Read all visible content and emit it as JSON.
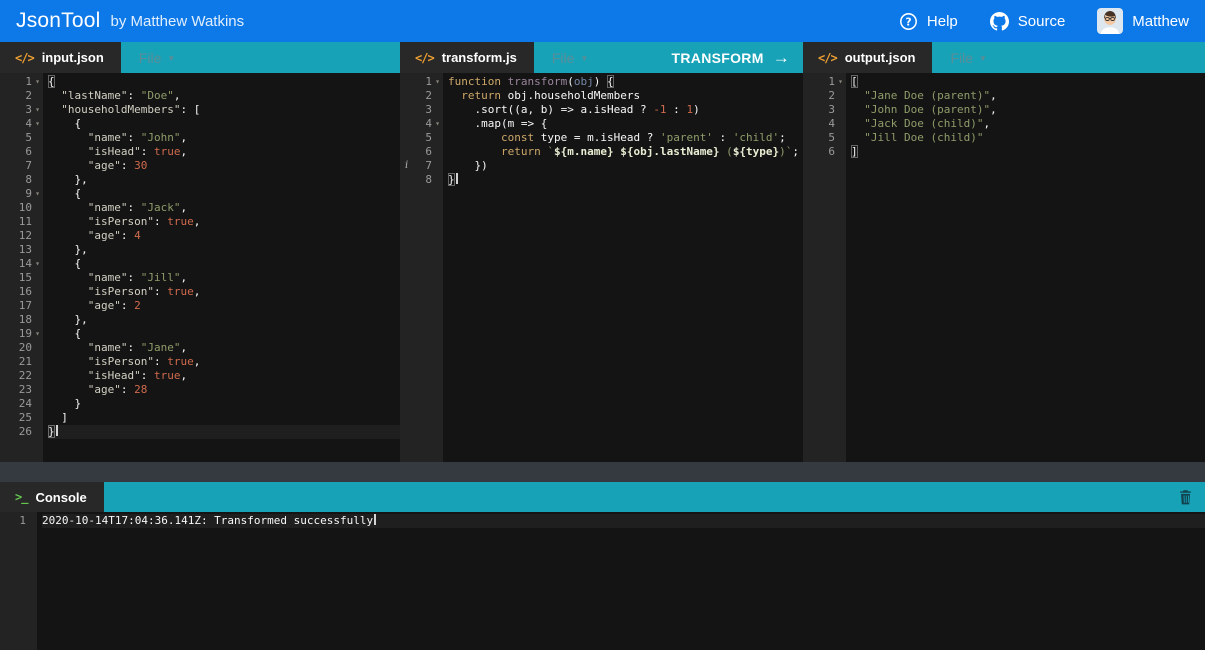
{
  "navbar": {
    "brand": "JsonTool",
    "byline": "by Matthew Watkins",
    "links": [
      {
        "icon": "help-circle-icon",
        "label": "Help"
      },
      {
        "icon": "github-icon",
        "label": "Source"
      },
      {
        "icon": "user-avatar",
        "label": "Matthew"
      }
    ]
  },
  "colors": {
    "navbar_blue": "#0d78e8",
    "panel_teal": "#17a2b8",
    "tab_dark": "#282828",
    "editor_background": "#141414",
    "gutter_background": "#232323",
    "string_green": "#8f9d6a",
    "number_red": "#cf6a4c",
    "keyword_tan": "#cda869"
  },
  "panels": {
    "input": {
      "tab_label": "input.json",
      "tab_icon": "code-icon",
      "menu_label": "File"
    },
    "transform": {
      "tab_label": "transform.js",
      "tab_icon": "code-icon",
      "menu_label": "File",
      "action_label": "TRANSFORM",
      "action_icon": "arrow-right-icon"
    },
    "output": {
      "tab_label": "output.json",
      "tab_icon": "code-icon",
      "menu_label": "File"
    },
    "console": {
      "tab_label": "Console",
      "tab_icon": "terminal-icon",
      "clear_icon": "trash-icon"
    }
  },
  "editors": {
    "input": {
      "lines": [
        {
          "tokens": [
            [
              "p",
              "{",
              "box"
            ]
          ],
          "fold": true
        },
        {
          "tokens": [
            [
              "k",
              "  \"lastName\""
            ],
            [
              "p",
              ": "
            ],
            [
              "s",
              "\"Doe\""
            ],
            [
              "p",
              ","
            ]
          ]
        },
        {
          "tokens": [
            [
              "k",
              "  \"householdMembers\""
            ],
            [
              "p",
              ": ["
            ]
          ],
          "fold": true
        },
        {
          "tokens": [
            [
              "p",
              "    {"
            ]
          ],
          "fold": true
        },
        {
          "tokens": [
            [
              "k",
              "      \"name\""
            ],
            [
              "p",
              ": "
            ],
            [
              "s",
              "\"John\""
            ],
            [
              "p",
              ","
            ]
          ]
        },
        {
          "tokens": [
            [
              "k",
              "      \"isHead\""
            ],
            [
              "p",
              ": "
            ],
            [
              "b",
              "true"
            ],
            [
              "p",
              ","
            ]
          ]
        },
        {
          "tokens": [
            [
              "k",
              "      \"age\""
            ],
            [
              "p",
              ": "
            ],
            [
              "n",
              "30"
            ]
          ]
        },
        {
          "tokens": [
            [
              "p",
              "    },"
            ]
          ]
        },
        {
          "tokens": [
            [
              "p",
              "    {"
            ]
          ],
          "fold": true
        },
        {
          "tokens": [
            [
              "k",
              "      \"name\""
            ],
            [
              "p",
              ": "
            ],
            [
              "s",
              "\"Jack\""
            ],
            [
              "p",
              ","
            ]
          ]
        },
        {
          "tokens": [
            [
              "k",
              "      \"isPerson\""
            ],
            [
              "p",
              ": "
            ],
            [
              "b",
              "true"
            ],
            [
              "p",
              ","
            ]
          ]
        },
        {
          "tokens": [
            [
              "k",
              "      \"age\""
            ],
            [
              "p",
              ": "
            ],
            [
              "n",
              "4"
            ]
          ]
        },
        {
          "tokens": [
            [
              "p",
              "    },"
            ]
          ]
        },
        {
          "tokens": [
            [
              "p",
              "    {"
            ]
          ],
          "fold": true
        },
        {
          "tokens": [
            [
              "k",
              "      \"name\""
            ],
            [
              "p",
              ": "
            ],
            [
              "s",
              "\"Jill\""
            ],
            [
              "p",
              ","
            ]
          ]
        },
        {
          "tokens": [
            [
              "k",
              "      \"isPerson\""
            ],
            [
              "p",
              ": "
            ],
            [
              "b",
              "true"
            ],
            [
              "p",
              ","
            ]
          ]
        },
        {
          "tokens": [
            [
              "k",
              "      \"age\""
            ],
            [
              "p",
              ": "
            ],
            [
              "n",
              "2"
            ]
          ]
        },
        {
          "tokens": [
            [
              "p",
              "    },"
            ]
          ]
        },
        {
          "tokens": [
            [
              "p",
              "    {"
            ]
          ],
          "fold": true
        },
        {
          "tokens": [
            [
              "k",
              "      \"name\""
            ],
            [
              "p",
              ": "
            ],
            [
              "s",
              "\"Jane\""
            ],
            [
              "p",
              ","
            ]
          ]
        },
        {
          "tokens": [
            [
              "k",
              "      \"isPerson\""
            ],
            [
              "p",
              ": "
            ],
            [
              "b",
              "true"
            ],
            [
              "p",
              ","
            ]
          ]
        },
        {
          "tokens": [
            [
              "k",
              "      \"isHead\""
            ],
            [
              "p",
              ": "
            ],
            [
              "b",
              "true"
            ],
            [
              "p",
              ","
            ]
          ]
        },
        {
          "tokens": [
            [
              "k",
              "      \"age\""
            ],
            [
              "p",
              ": "
            ],
            [
              "n",
              "28"
            ]
          ]
        },
        {
          "tokens": [
            [
              "p",
              "    }"
            ]
          ]
        },
        {
          "tokens": [
            [
              "p",
              "  ]"
            ]
          ]
        },
        {
          "tokens": [
            [
              "p",
              "}",
              "box"
            ]
          ],
          "active": true,
          "cursor": true
        }
      ]
    },
    "transform": {
      "lines": [
        {
          "tokens": [
            [
              "kw",
              "function"
            ],
            [
              "p",
              " "
            ],
            [
              "fn",
              "transform"
            ],
            [
              "p",
              "("
            ],
            [
              "prm",
              "obj"
            ],
            [
              "p",
              ") "
            ],
            [
              "p",
              "{",
              "box"
            ]
          ],
          "fold": true
        },
        {
          "tokens": [
            [
              "p",
              "  "
            ],
            [
              "kw",
              "return"
            ],
            [
              "p",
              " obj.householdMembers"
            ]
          ]
        },
        {
          "tokens": [
            [
              "p",
              "    .sort((a, b) => a.isHead ? "
            ],
            [
              "n",
              "-1"
            ],
            [
              "p",
              " : "
            ],
            [
              "n",
              "1"
            ],
            [
              "p",
              ")"
            ]
          ]
        },
        {
          "tokens": [
            [
              "p",
              "    .map(m => {"
            ]
          ],
          "fold": true
        },
        {
          "tokens": [
            [
              "p",
              "        "
            ],
            [
              "kw",
              "const"
            ],
            [
              "p",
              " type = m.isHead ? "
            ],
            [
              "s",
              "'parent'"
            ],
            [
              "p",
              " : "
            ],
            [
              "s",
              "'child'"
            ],
            [
              "p",
              ";"
            ]
          ]
        },
        {
          "tokens": [
            [
              "p",
              "        "
            ],
            [
              "kw",
              "return"
            ],
            [
              "p",
              " "
            ],
            [
              "s",
              "`"
            ],
            [
              "i",
              "${m.name}"
            ],
            [
              "s",
              " "
            ],
            [
              "i",
              "${obj.lastName}"
            ],
            [
              "s",
              " ("
            ],
            [
              "i",
              "${type}"
            ],
            [
              "s",
              ")`"
            ],
            [
              "p",
              ";"
            ]
          ]
        },
        {
          "tokens": [
            [
              "p",
              "    })"
            ]
          ],
          "ann": "i"
        },
        {
          "tokens": [
            [
              "p",
              "}",
              "box"
            ]
          ],
          "cursor": true
        }
      ]
    },
    "output": {
      "lines": [
        {
          "tokens": [
            [
              "p",
              "[",
              "box"
            ]
          ],
          "fold": true
        },
        {
          "tokens": [
            [
              "s",
              "  \"Jane Doe (parent)\""
            ],
            [
              "p",
              ","
            ]
          ]
        },
        {
          "tokens": [
            [
              "s",
              "  \"John Doe (parent)\""
            ],
            [
              "p",
              ","
            ]
          ]
        },
        {
          "tokens": [
            [
              "s",
              "  \"Jack Doe (child)\""
            ],
            [
              "p",
              ","
            ]
          ]
        },
        {
          "tokens": [
            [
              "s",
              "  \"Jill Doe (child)\""
            ]
          ]
        },
        {
          "tokens": [
            [
              "p",
              "]",
              "box"
            ]
          ]
        }
      ]
    },
    "console": {
      "lines": [
        {
          "tokens": [
            [
              "p",
              "2020-10-14T17:04:36.141Z: Transformed successfully"
            ]
          ],
          "active": true,
          "cursor": true
        }
      ]
    }
  }
}
